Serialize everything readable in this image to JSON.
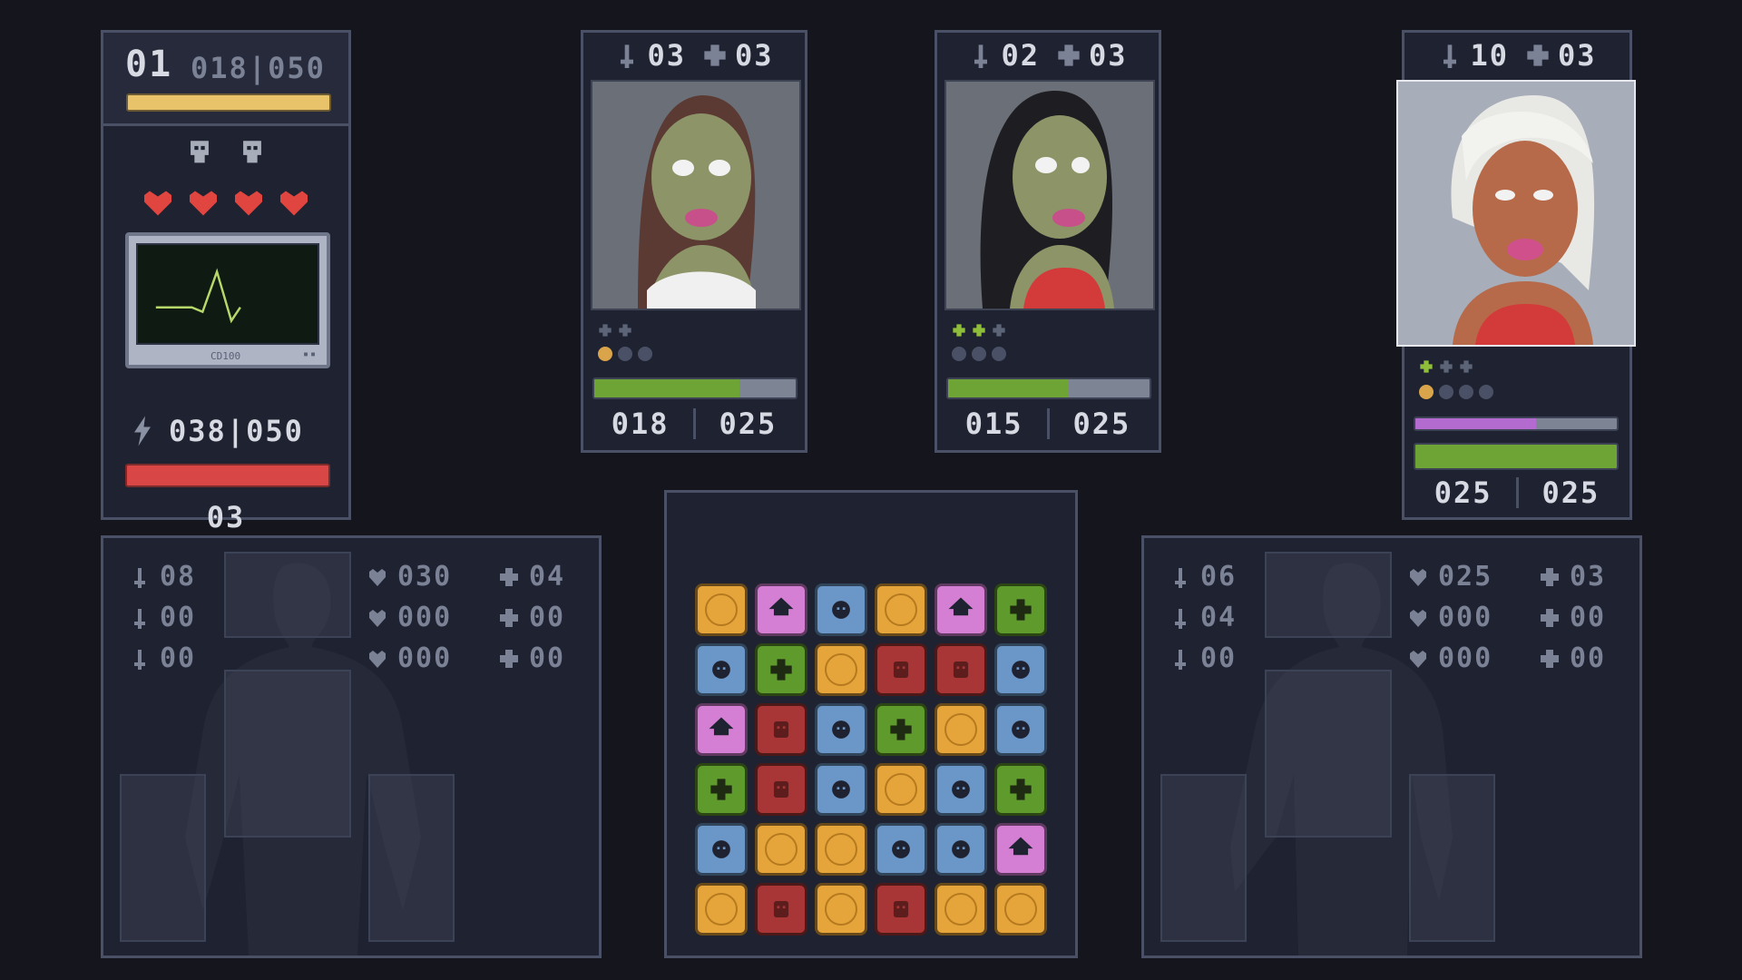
{
  "player": {
    "level": "01",
    "xp": "018|050",
    "energy": "038|050",
    "count": "03",
    "skulls": 2,
    "hearts": 4,
    "monitor_brand": "CD100",
    "monitor_dots": "▪▪"
  },
  "enemies": [
    {
      "attack": "03",
      "defense": "03",
      "hp": "018",
      "hp_max": "025",
      "hp_fraction": 0.72,
      "buffs": [
        "inactive",
        "inactive"
      ],
      "orbs": [
        "gold",
        "empty",
        "empty"
      ]
    },
    {
      "attack": "02",
      "defense": "03",
      "hp": "015",
      "hp_max": "025",
      "hp_fraction": 0.6,
      "buffs": [
        "active",
        "active",
        "inactive"
      ],
      "orbs": [
        "empty",
        "empty",
        "empty"
      ]
    },
    {
      "attack": "10",
      "defense": "03",
      "hp": "025",
      "hp_max": "025",
      "hp_fraction": 1.0,
      "mana_fraction": 0.6,
      "buffs": [
        "active",
        "inactive",
        "inactive"
      ],
      "orbs": [
        "gold",
        "empty",
        "empty",
        "empty"
      ]
    }
  ],
  "equip_left": {
    "col1": [
      "08",
      "00",
      "00"
    ],
    "col2": [
      "030",
      "000",
      "000"
    ],
    "col3": [
      "04",
      "00",
      "00"
    ]
  },
  "equip_right": {
    "col1": [
      "06",
      "04",
      "00"
    ],
    "col2": [
      "025",
      "000",
      "000"
    ],
    "col3": [
      "03",
      "00",
      "00"
    ]
  },
  "board": [
    [
      "gold",
      "pink",
      "blue",
      "gold",
      "pink",
      "green"
    ],
    [
      "blue",
      "green",
      "gold",
      "red",
      "red",
      "blue"
    ],
    [
      "pink",
      "red",
      "blue",
      "green",
      "gold",
      "blue"
    ],
    [
      "green",
      "red",
      "blue",
      "gold",
      "blue",
      "green"
    ],
    [
      "blue",
      "gold",
      "gold",
      "blue",
      "blue",
      "pink"
    ],
    [
      "gold",
      "red",
      "gold",
      "red",
      "gold",
      "gold"
    ]
  ],
  "colors": {
    "gold": "#e6a53a",
    "pink": "#d57fd4",
    "blue": "#6b97c8",
    "red": "#a83636",
    "green": "#5f9a2c"
  },
  "icons": {
    "attack": "sword-icon",
    "defense": "cross-icon",
    "health": "heart-icon"
  }
}
